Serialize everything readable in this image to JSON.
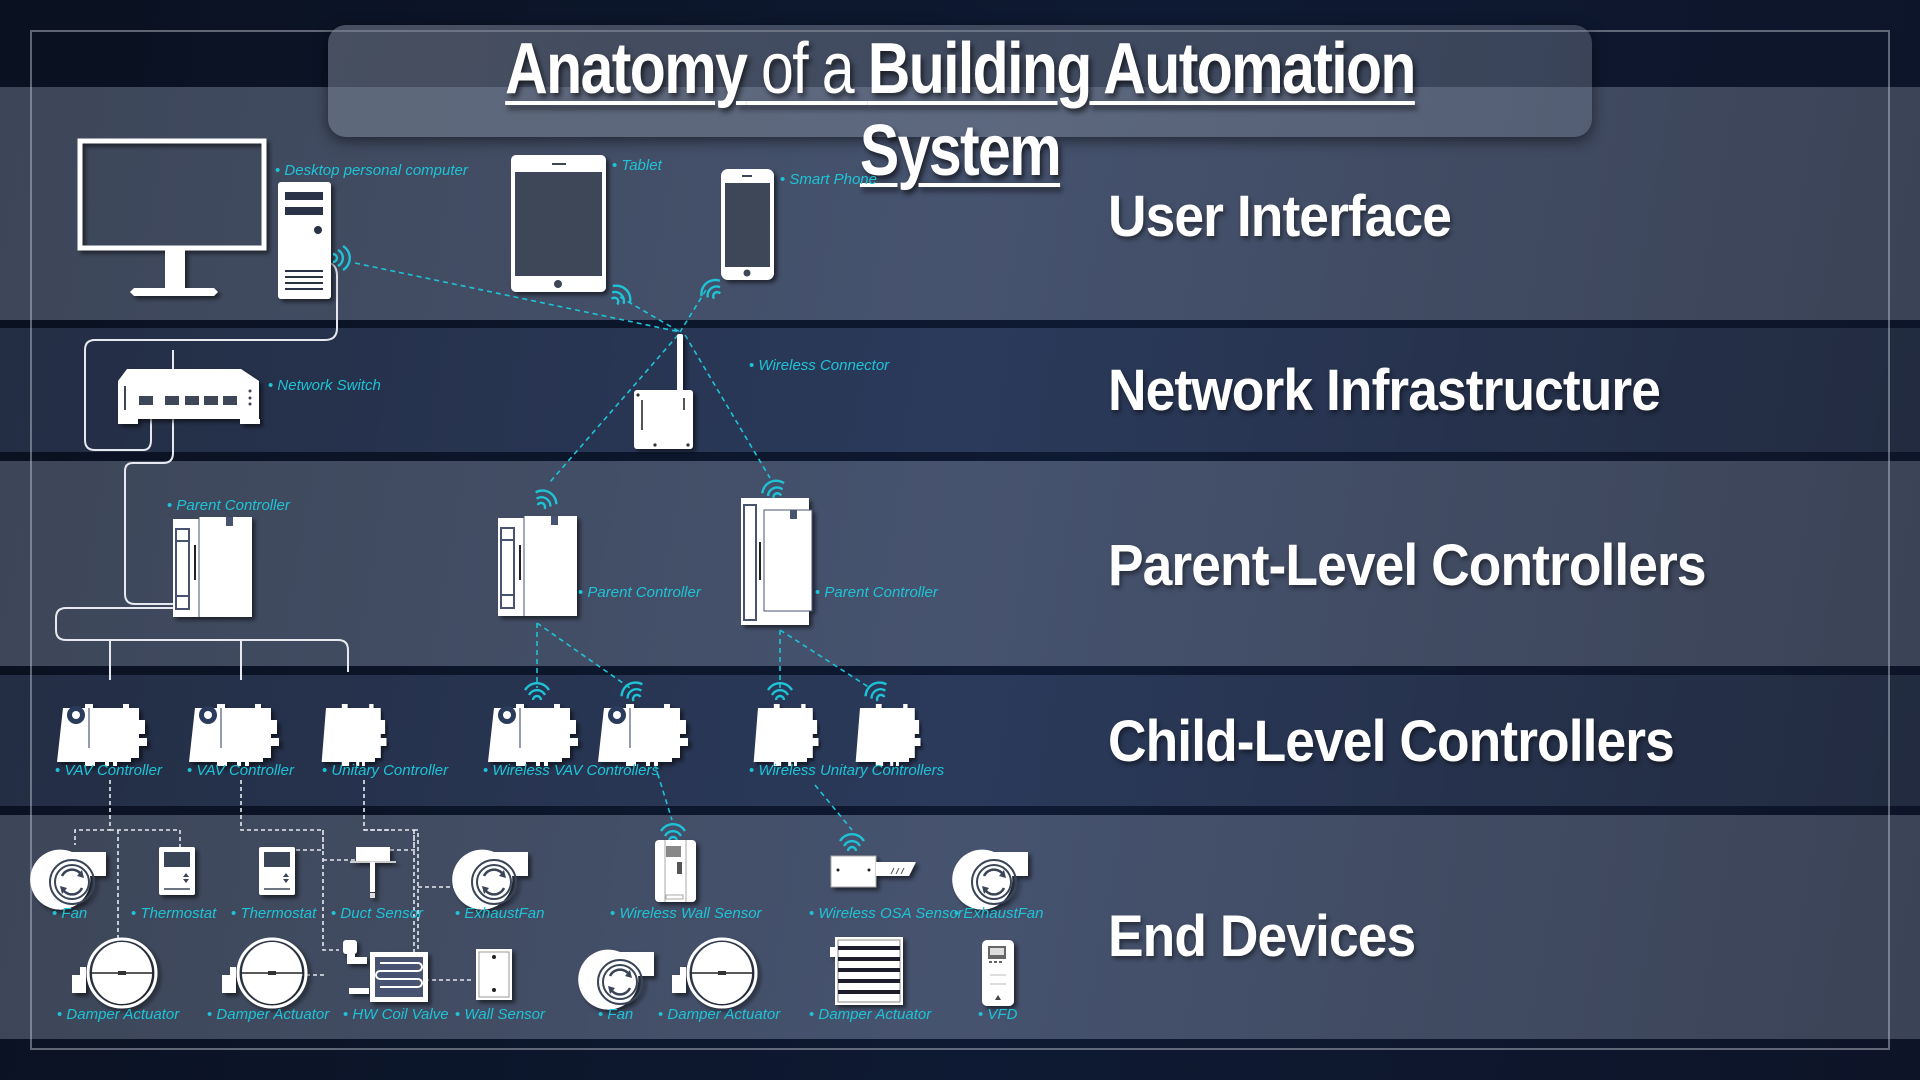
{
  "title": {
    "part1": "Anatomy",
    "part2": " of a ",
    "part3": "Building Automation System"
  },
  "layers": [
    {
      "id": "user-interface",
      "label": "User Interface"
    },
    {
      "id": "network-infrastructure",
      "label": "Network Infrastructure"
    },
    {
      "id": "parent-level-controllers",
      "label": "Parent-Level Controllers"
    },
    {
      "id": "child-level-controllers",
      "label": "Child-Level Controllers"
    },
    {
      "id": "end-devices",
      "label": "End Devices"
    }
  ],
  "devices": {
    "user_interface": {
      "desktop": "Desktop personal computer",
      "tablet": "Tablet",
      "phone": "Smart Phone"
    },
    "network": {
      "switch": "Network Switch",
      "wireless_connector": "Wireless Connector"
    },
    "parent": {
      "wired": "Parent Controller",
      "wireless_1": "Parent Controller",
      "wireless_2": "Parent Controller"
    },
    "child": {
      "vav_1": "VAV Controller",
      "vav_2": "VAV Controller",
      "unitary": "Unitary Controller",
      "wireless_vav": "Wireless VAV Controllers",
      "wireless_unitary": "Wireless Unitary Controllers"
    },
    "end": {
      "fan_1": "Fan",
      "thermostat_1": "Thermostat",
      "thermostat_2": "Thermostat",
      "duct_sensor": "Duct Sensor",
      "exhaust_fan_1": "ExhaustFan",
      "wireless_wall_sensor": "Wireless Wall Sensor",
      "wireless_osa_sensor": "Wireless OSA Sensor",
      "exhaust_fan_2": "ExhaustFan",
      "damper_actuator_1": "Damper Actuator",
      "damper_actuator_2": "Damper Actuator",
      "hw_coil_valve": "HW Coil Valve",
      "wall_sensor": "Wall Sensor",
      "fan_2": "Fan",
      "damper_actuator_3": "Damper Actuator",
      "damper_actuator_4": "Damper Actuator",
      "vfd": "VFD"
    }
  },
  "colors": {
    "accent": "#1ec3d6",
    "wire": "#e6e9ef",
    "device": "#ffffff"
  }
}
